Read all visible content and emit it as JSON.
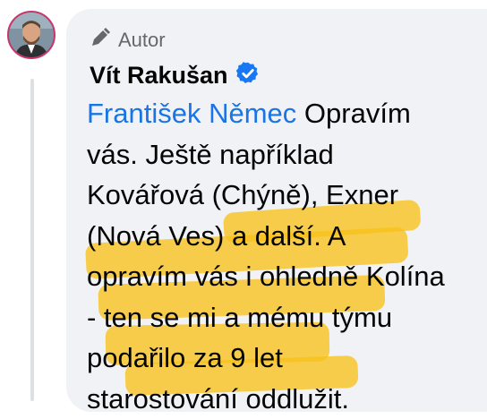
{
  "comment": {
    "badge_label": "Autor",
    "author_name": "Vít Rakušan",
    "mention": "František Němec",
    "lines": [
      " Opravím",
      "vás. Ještě například",
      "Kovářová (Chýně), Exner",
      "(Nová Ves) a další. A",
      "opravím vás i ohledně Kolína",
      "- ten se mi a mému týmu",
      "podařilo za 9 let",
      "starostování oddlužit."
    ]
  },
  "colors": {
    "mention": "#1b74e4",
    "highlight": "#f8c21a",
    "bubble": "#f0f2f5",
    "verified": "#1877f2",
    "avatar_ring": "#c8356b"
  },
  "icons": {
    "badge": "pen-icon",
    "verified": "verified-badge-icon"
  }
}
